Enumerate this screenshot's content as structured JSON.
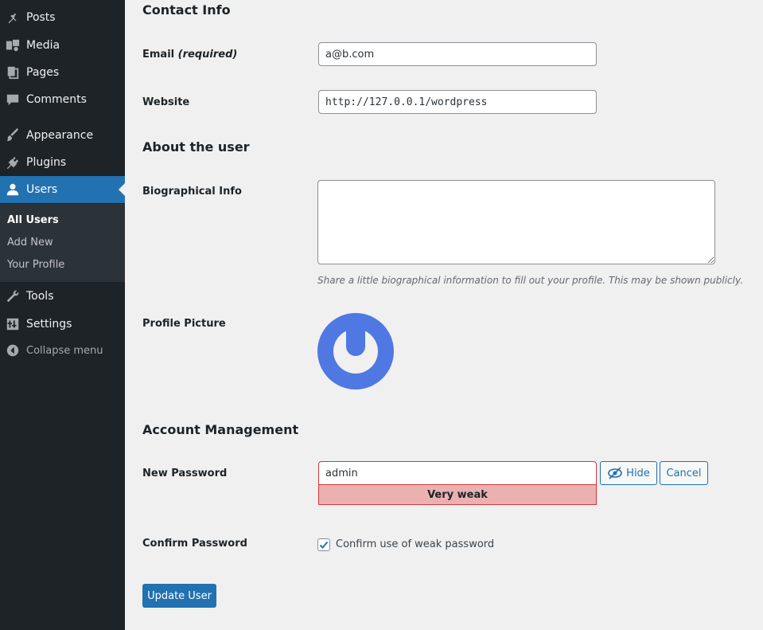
{
  "sidebar": {
    "items": [
      {
        "label": "Posts",
        "icon": "pin-icon"
      },
      {
        "label": "Media",
        "icon": "media-icon"
      },
      {
        "label": "Pages",
        "icon": "pages-icon"
      },
      {
        "label": "Comments",
        "icon": "comment-icon"
      },
      {
        "label": "Appearance",
        "icon": "paintbrush-icon"
      },
      {
        "label": "Plugins",
        "icon": "plug-icon"
      },
      {
        "label": "Users",
        "icon": "user-icon",
        "active": true
      },
      {
        "label": "Tools",
        "icon": "wrench-icon"
      },
      {
        "label": "Settings",
        "icon": "settings-icon"
      },
      {
        "label": "Collapse menu",
        "icon": "collapse-icon"
      }
    ],
    "submenu": [
      {
        "label": "All Users",
        "current": true
      },
      {
        "label": "Add New"
      },
      {
        "label": "Your Profile"
      }
    ]
  },
  "contact_info": {
    "heading": "Contact Info",
    "email_label": "Email",
    "email_required": "(required)",
    "email_value": "a@b.com",
    "website_label": "Website",
    "website_value": "http://127.0.0.1/wordpress"
  },
  "about": {
    "heading": "About the user",
    "bio_label": "Biographical Info",
    "bio_value": "",
    "bio_description": "Share a little biographical information to fill out your profile. This may be shown publicly.",
    "picture_label": "Profile Picture"
  },
  "account": {
    "heading": "Account Management",
    "password_label": "New Password",
    "password_value": "admin",
    "hide_label": "Hide",
    "cancel_label": "Cancel",
    "strength_label": "Very weak",
    "confirm_label": "Confirm Password",
    "confirm_text": "Confirm use of weak password",
    "confirm_checked": true
  },
  "submit_label": "Update User",
  "colors": {
    "sidebar_bg": "#1d2327",
    "accent": "#2271b1",
    "avatar": "#4f78e3",
    "weak": "#ebb1b1"
  }
}
